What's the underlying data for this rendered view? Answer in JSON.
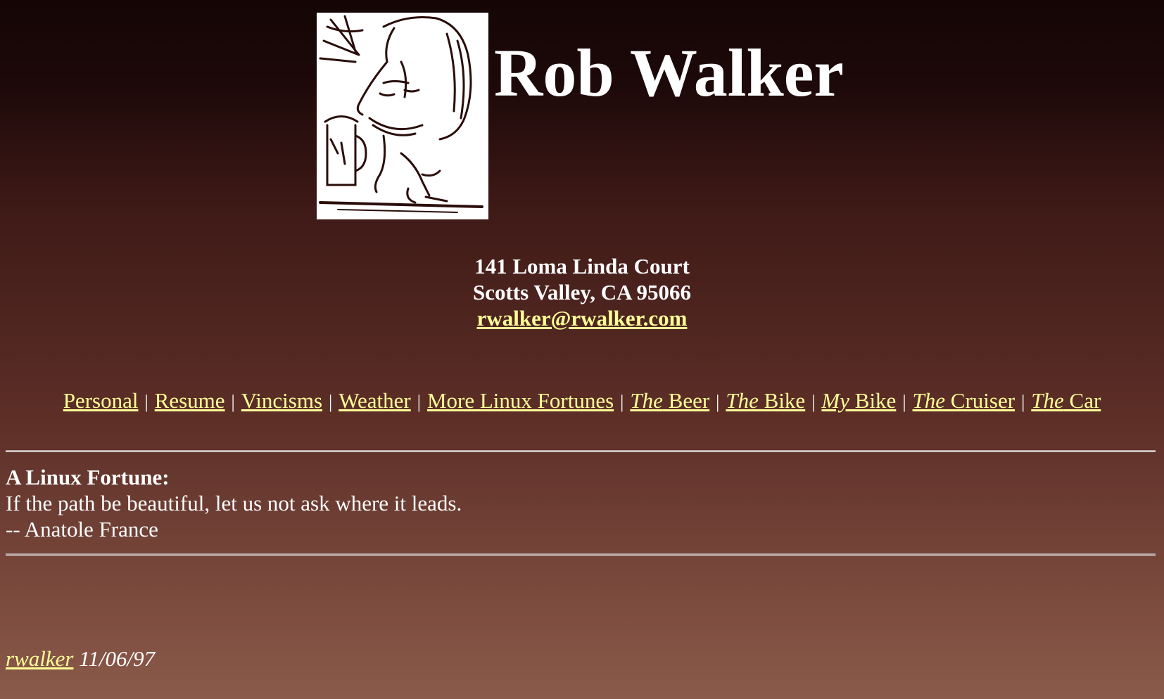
{
  "header": {
    "portrait_icon": "caricature-portrait",
    "title": "Rob Walker"
  },
  "address": {
    "street": "141 Loma Linda Court",
    "city_line": "Scotts Valley, CA 95066",
    "email": "rwalker@rwalker.com"
  },
  "nav": {
    "separator": "|",
    "items": [
      {
        "prefix": "",
        "label": "Personal"
      },
      {
        "prefix": "",
        "label": "Resume"
      },
      {
        "prefix": "",
        "label": "Vincisms"
      },
      {
        "prefix": "",
        "label": "Weather"
      },
      {
        "prefix": "",
        "label": "More Linux Fortunes"
      },
      {
        "prefix": "The",
        "label": " Beer"
      },
      {
        "prefix": "The",
        "label": " Bike"
      },
      {
        "prefix": "My",
        "label": " Bike"
      },
      {
        "prefix": "The",
        "label": " Cruiser"
      },
      {
        "prefix": "The",
        "label": " Car"
      }
    ]
  },
  "fortune": {
    "label": "A Linux Fortune:",
    "quote": "If the path be beautiful, let us not ask where it leads.",
    "attribution": "-- Anatole France"
  },
  "footer": {
    "author_link": "rwalker",
    "date": "11/06/97"
  },
  "colors": {
    "link": "#ffff99",
    "text": "#ffffff",
    "background_top": "#150505",
    "background_bottom": "#8a5a4a"
  }
}
